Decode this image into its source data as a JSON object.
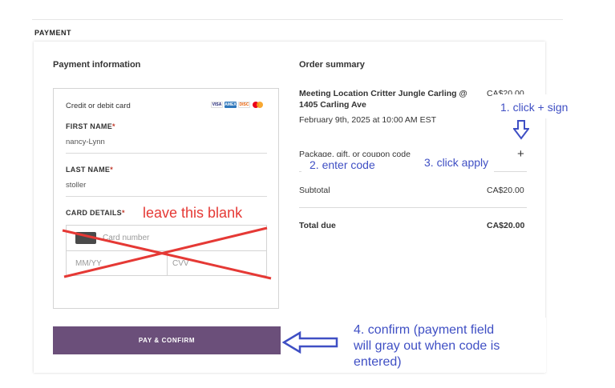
{
  "section": {
    "label": "PAYMENT"
  },
  "payment": {
    "heading": "Payment information",
    "card_label": "Credit or debit card",
    "card_brands": [
      "VISA",
      "AMEX",
      "DISC",
      "MC"
    ],
    "first_name": {
      "label": "FIRST NAME",
      "required": "*",
      "value": "nancy-Lynn"
    },
    "last_name": {
      "label": "LAST NAME",
      "required": "*",
      "value": "stoller"
    },
    "card_details": {
      "label": "CARD DETAILS",
      "required": "*",
      "number_placeholder": "Card number",
      "expiry_placeholder": "MM/YY",
      "cvv_placeholder": "CVV"
    },
    "pay_button": "PAY & CONFIRM",
    "pay_button_color": "#6b4f7a"
  },
  "order": {
    "heading": "Order summary",
    "item_title_1": "Meeting Location Critter Jungle Carling @",
    "item_title_2": "1405 Carling Ave",
    "item_price": "CA$20.00",
    "item_date": "February 9th, 2025 at 10:00 AM EST",
    "coupon_label": "Package, gift, or coupon code",
    "coupon_toggle": "+",
    "subtotal_label": "Subtotal",
    "subtotal_value": "CA$20.00",
    "total_label": "Total due",
    "total_value": "CA$20.00"
  },
  "annotations": {
    "leave_blank": "leave this blank",
    "step1": "1. click + sign",
    "step2": "2. enter code",
    "step3": "3. click apply",
    "step4_line1": "4. confirm (payment field",
    "step4_line2": "will gray out when code is",
    "step4_line3": "entered)",
    "red_color": "#e53935",
    "blue_color": "#3f4fc4"
  }
}
